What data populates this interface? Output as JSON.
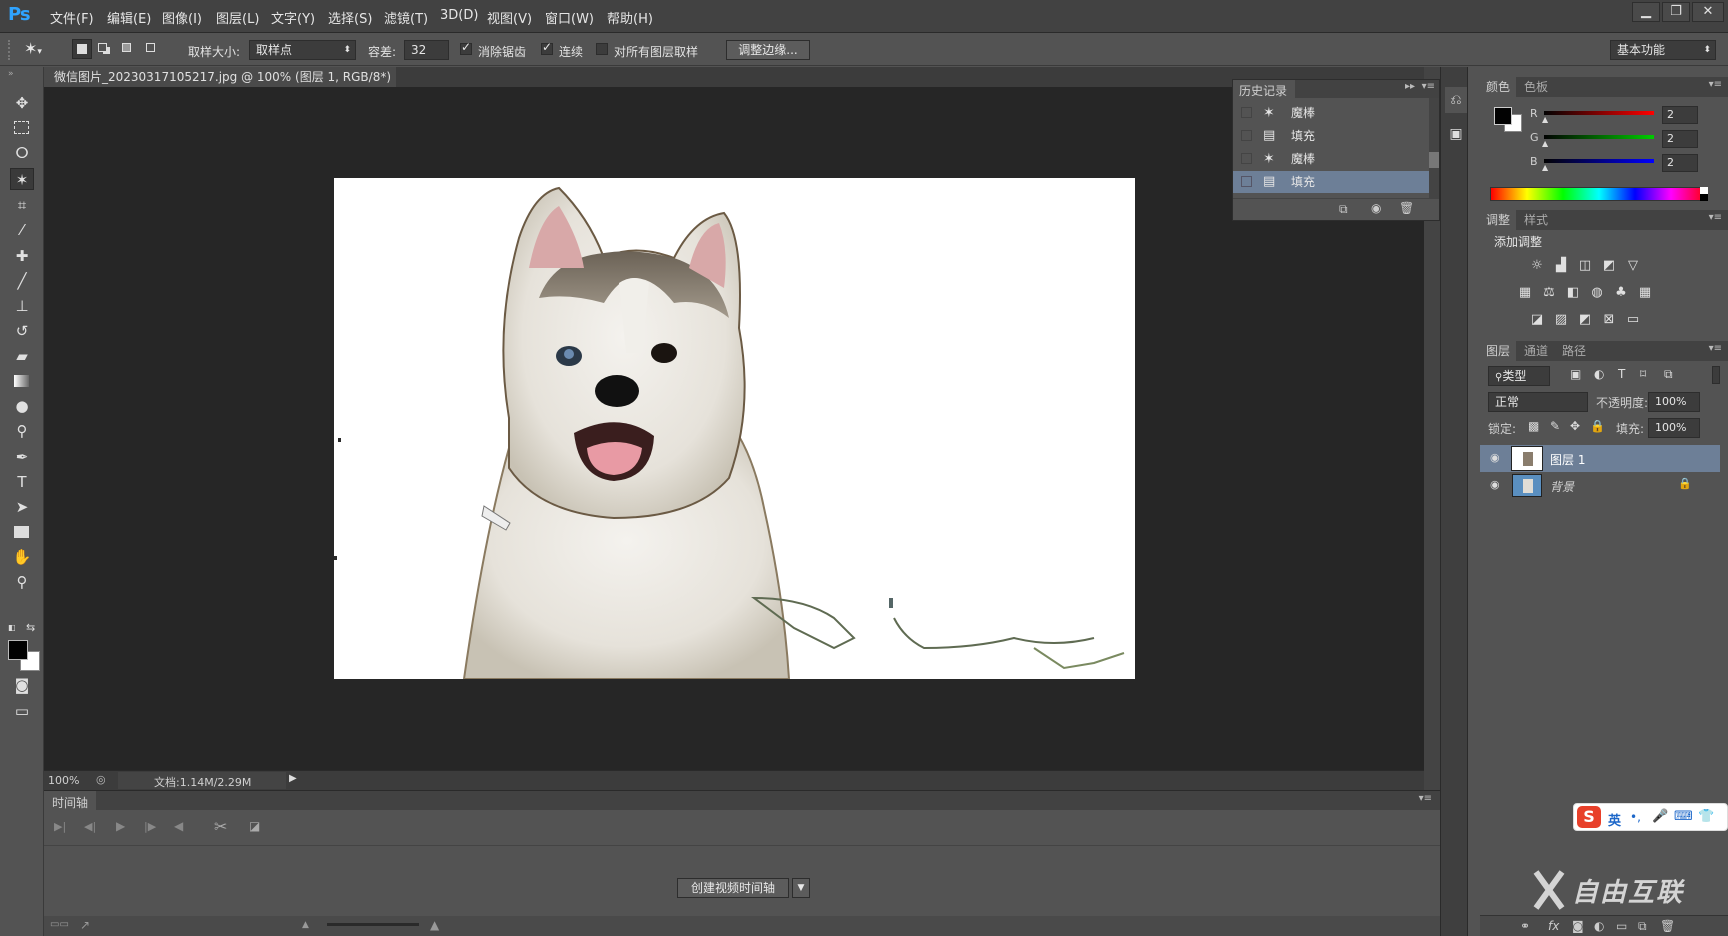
{
  "app": {
    "logo": "Ps"
  },
  "menubar": {
    "items": [
      "文件(F)",
      "编辑(E)",
      "图像(I)",
      "图层(L)",
      "文字(Y)",
      "选择(S)",
      "滤镜(T)",
      "3D(D)",
      "视图(V)",
      "窗口(W)",
      "帮助(H)"
    ]
  },
  "window_buttons": {
    "minimize": "▁",
    "restore": "❐",
    "close": "✕"
  },
  "options": {
    "sample_size_label": "取样大小:",
    "sample_size_value": "取样点",
    "tolerance_label": "容差:",
    "tolerance_value": "32",
    "antialias_label": "消除锯齿",
    "antialias_checked": true,
    "contiguous_label": "连续",
    "contiguous_checked": true,
    "all_layers_label": "对所有图层取样",
    "all_layers_checked": false,
    "refine_edge_label": "调整边缘...",
    "workspace_value": "基本功能"
  },
  "document": {
    "tab_title": "微信图片_20230317105217.jpg @ 100% (图层 1, RGB/8*) *",
    "close_glyph": "×"
  },
  "status": {
    "zoom": "100%",
    "doc_info": "文档:1.14M/2.29M"
  },
  "timeline": {
    "title": "时间轴",
    "create_button": "创建视频时间轴"
  },
  "history": {
    "title": "历史记录",
    "items": [
      {
        "label": "魔棒",
        "icon": "magic-wand-icon"
      },
      {
        "label": "填充",
        "icon": "fill-icon"
      },
      {
        "label": "魔棒",
        "icon": "magic-wand-icon"
      },
      {
        "label": "填充",
        "icon": "fill-icon",
        "selected": true
      }
    ]
  },
  "color_panel": {
    "tabs": [
      "颜色",
      "色板"
    ],
    "channels": [
      {
        "label": "R",
        "value": "2",
        "color": "#ff0000"
      },
      {
        "label": "G",
        "value": "2",
        "color": "#00cc00"
      },
      {
        "label": "B",
        "value": "2",
        "color": "#0000ff"
      }
    ]
  },
  "adjustments": {
    "tabs": [
      "调整",
      "样式"
    ],
    "add_label": "添加调整"
  },
  "layers_panel": {
    "tabs": [
      "图层",
      "通道",
      "路径"
    ],
    "filter_value": "类型",
    "blend_mode": "正常",
    "opacity_label": "不透明度:",
    "opacity_value": "100%",
    "lock_label": "锁定:",
    "fill_label": "填充:",
    "fill_value": "100%",
    "layers": [
      {
        "name": "图层 1",
        "selected": true
      },
      {
        "name": "背景",
        "locked": true
      }
    ]
  },
  "ime": {
    "label": "英"
  },
  "watermark": {
    "text": "自由互联"
  }
}
